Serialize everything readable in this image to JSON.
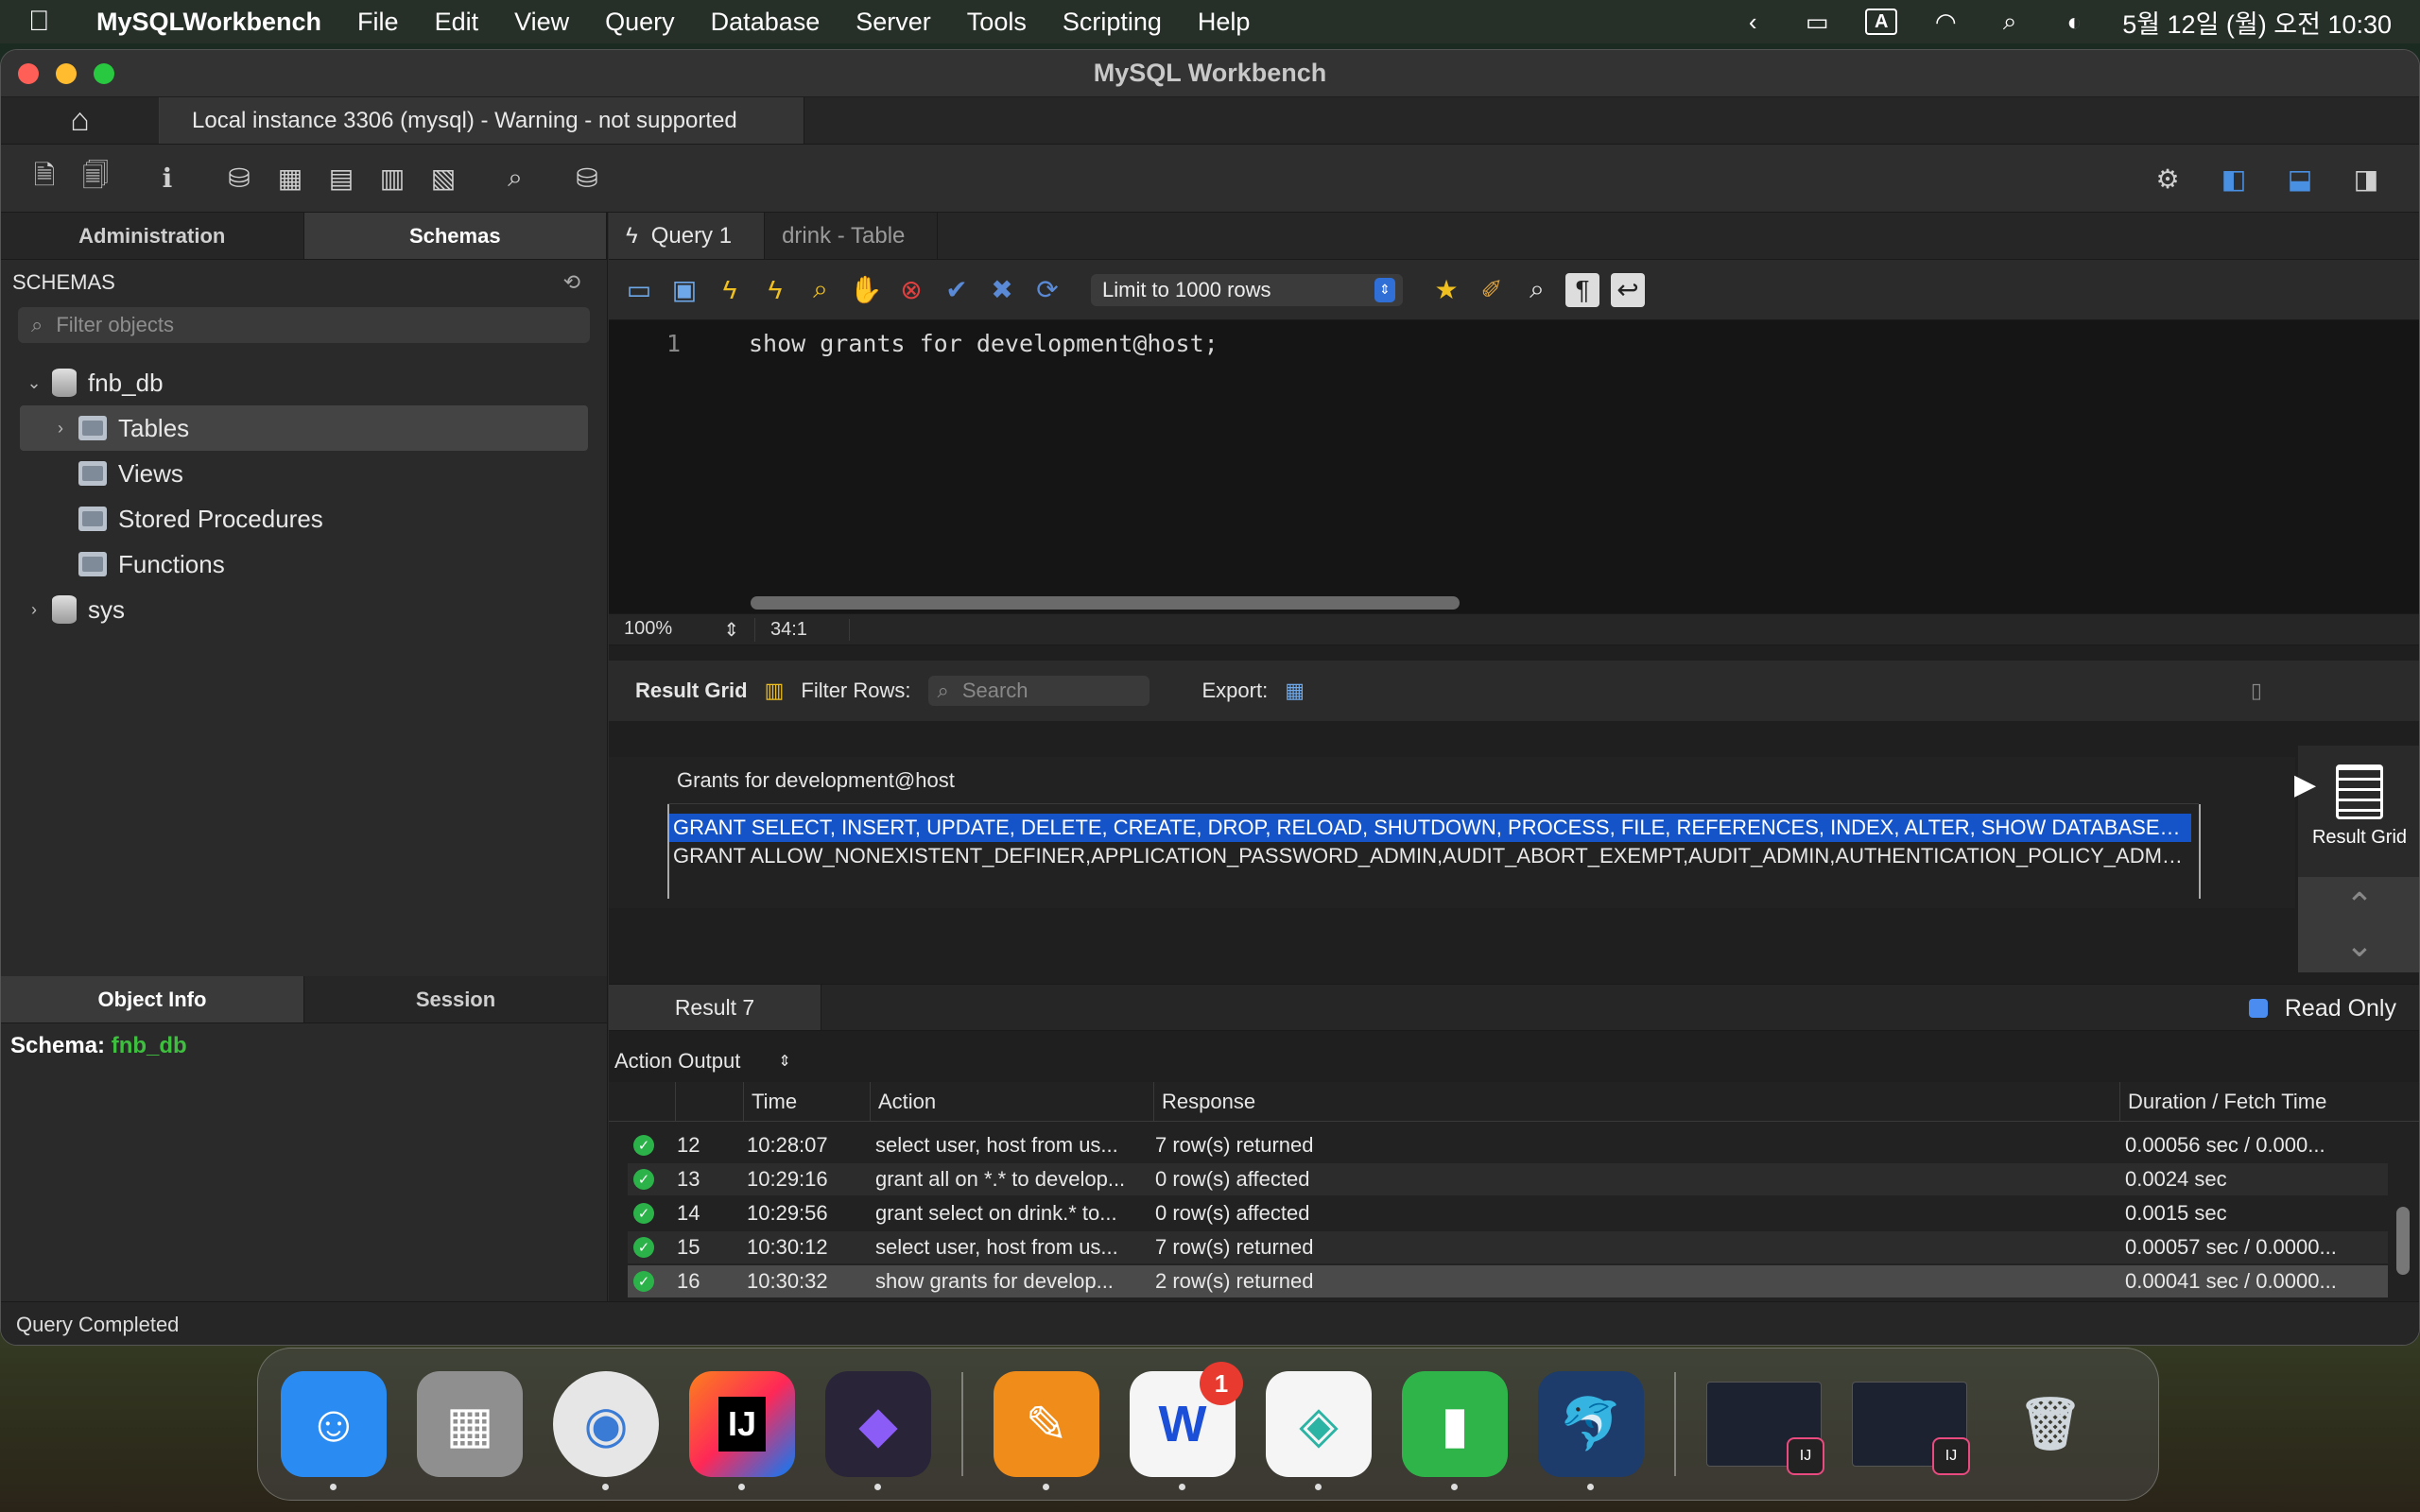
{
  "menubar": {
    "app_name": "MySQLWorkbench",
    "items": [
      "File",
      "Edit",
      "View",
      "Query",
      "Database",
      "Server",
      "Tools",
      "Scripting",
      "Help"
    ],
    "input_indicator": "A",
    "datetime": "5월 12일 (월) 오전 10:30"
  },
  "window": {
    "title": "MySQL Workbench",
    "connection_tab": "Local instance 3306 (mysql) - Warning - not supported"
  },
  "sidebar": {
    "tabs": [
      "Administration",
      "Schemas"
    ],
    "active_tab": "Schemas",
    "schemas_label": "SCHEMAS",
    "filter_placeholder": "Filter objects",
    "tree": {
      "db1": "fnb_db",
      "children": [
        "Tables",
        "Views",
        "Stored Procedures",
        "Functions"
      ],
      "db2": "sys"
    },
    "info_tabs": [
      "Object Info",
      "Session"
    ],
    "schema_label": "Schema:",
    "schema_value": "fnb_db"
  },
  "query": {
    "tabs": [
      "Query 1",
      "drink - Table"
    ],
    "limit_label": "Limit to 1000 rows",
    "line_number": "1",
    "sql": "show grants for development@host;",
    "zoom": "100%",
    "cursor_pos": "34:1"
  },
  "result": {
    "grid_label": "Result Grid",
    "filter_label": "Filter Rows:",
    "search_placeholder": "Search",
    "export_label": "Export:",
    "column_header": "Grants for development@host",
    "rows": [
      "GRANT SELECT, INSERT, UPDATE, DELETE, CREATE, DROP, RELOAD, SHUTDOWN, PROCESS, FILE, REFERENCES, INDEX, ALTER, SHOW DATABASE…",
      "GRANT ALLOW_NONEXISTENT_DEFINER,APPLICATION_PASSWORD_ADMIN,AUDIT_ABORT_EXEMPT,AUDIT_ADMIN,AUTHENTICATION_POLICY_ADM…"
    ],
    "side_button": "Result Grid",
    "result_tab": "Result 7",
    "read_only": "Read Only"
  },
  "output": {
    "selector_label": "Action Output",
    "columns": [
      "Time",
      "Action",
      "Response",
      "Duration / Fetch Time"
    ],
    "rows": [
      {
        "num": "12",
        "time": "10:28:07",
        "action": "select user, host from us...",
        "response": "7 row(s) returned",
        "duration": "0.00056 sec / 0.000..."
      },
      {
        "num": "13",
        "time": "10:29:16",
        "action": "grant all on *.* to develop...",
        "response": "0 row(s) affected",
        "duration": "0.0024 sec"
      },
      {
        "num": "14",
        "time": "10:29:56",
        "action": "grant select on drink.* to...",
        "response": "0 row(s) affected",
        "duration": "0.0015 sec"
      },
      {
        "num": "15",
        "time": "10:30:12",
        "action": "select user, host from us...",
        "response": "7 row(s) returned",
        "duration": "0.00057 sec / 0.0000..."
      },
      {
        "num": "16",
        "time": "10:30:32",
        "action": "show grants for develop...",
        "response": "2 row(s) returned",
        "duration": "0.00041 sec / 0.0000..."
      }
    ]
  },
  "status": "Query Completed",
  "dock": {
    "apps": [
      {
        "name": "finder-app",
        "glyph": "☺",
        "color": "#2a8cf2"
      },
      {
        "name": "launchpad-app",
        "glyph": "▦",
        "color": "#8f8f8f"
      },
      {
        "name": "chrome-app",
        "glyph": "◉",
        "color": "#d9d9d9"
      },
      {
        "name": "intellij-app",
        "glyph": "IJ",
        "color": "#d9345f"
      },
      {
        "name": "obsidian-app",
        "glyph": "◆",
        "color": "#2a2438"
      },
      {
        "name": "pages-app",
        "glyph": "✎",
        "color": "#f08d1a"
      },
      {
        "name": "naver-whale-app",
        "glyph": "W",
        "color": "#f5f5f5"
      },
      {
        "name": "naver-box-app",
        "glyph": "◈",
        "color": "#f5f5f5"
      },
      {
        "name": "numbers-app",
        "glyph": "▮",
        "color": "#2fb44a"
      },
      {
        "name": "mysql-workbench-app",
        "glyph": "🐬",
        "color": "#1d3c6b"
      }
    ],
    "badge": "1"
  }
}
